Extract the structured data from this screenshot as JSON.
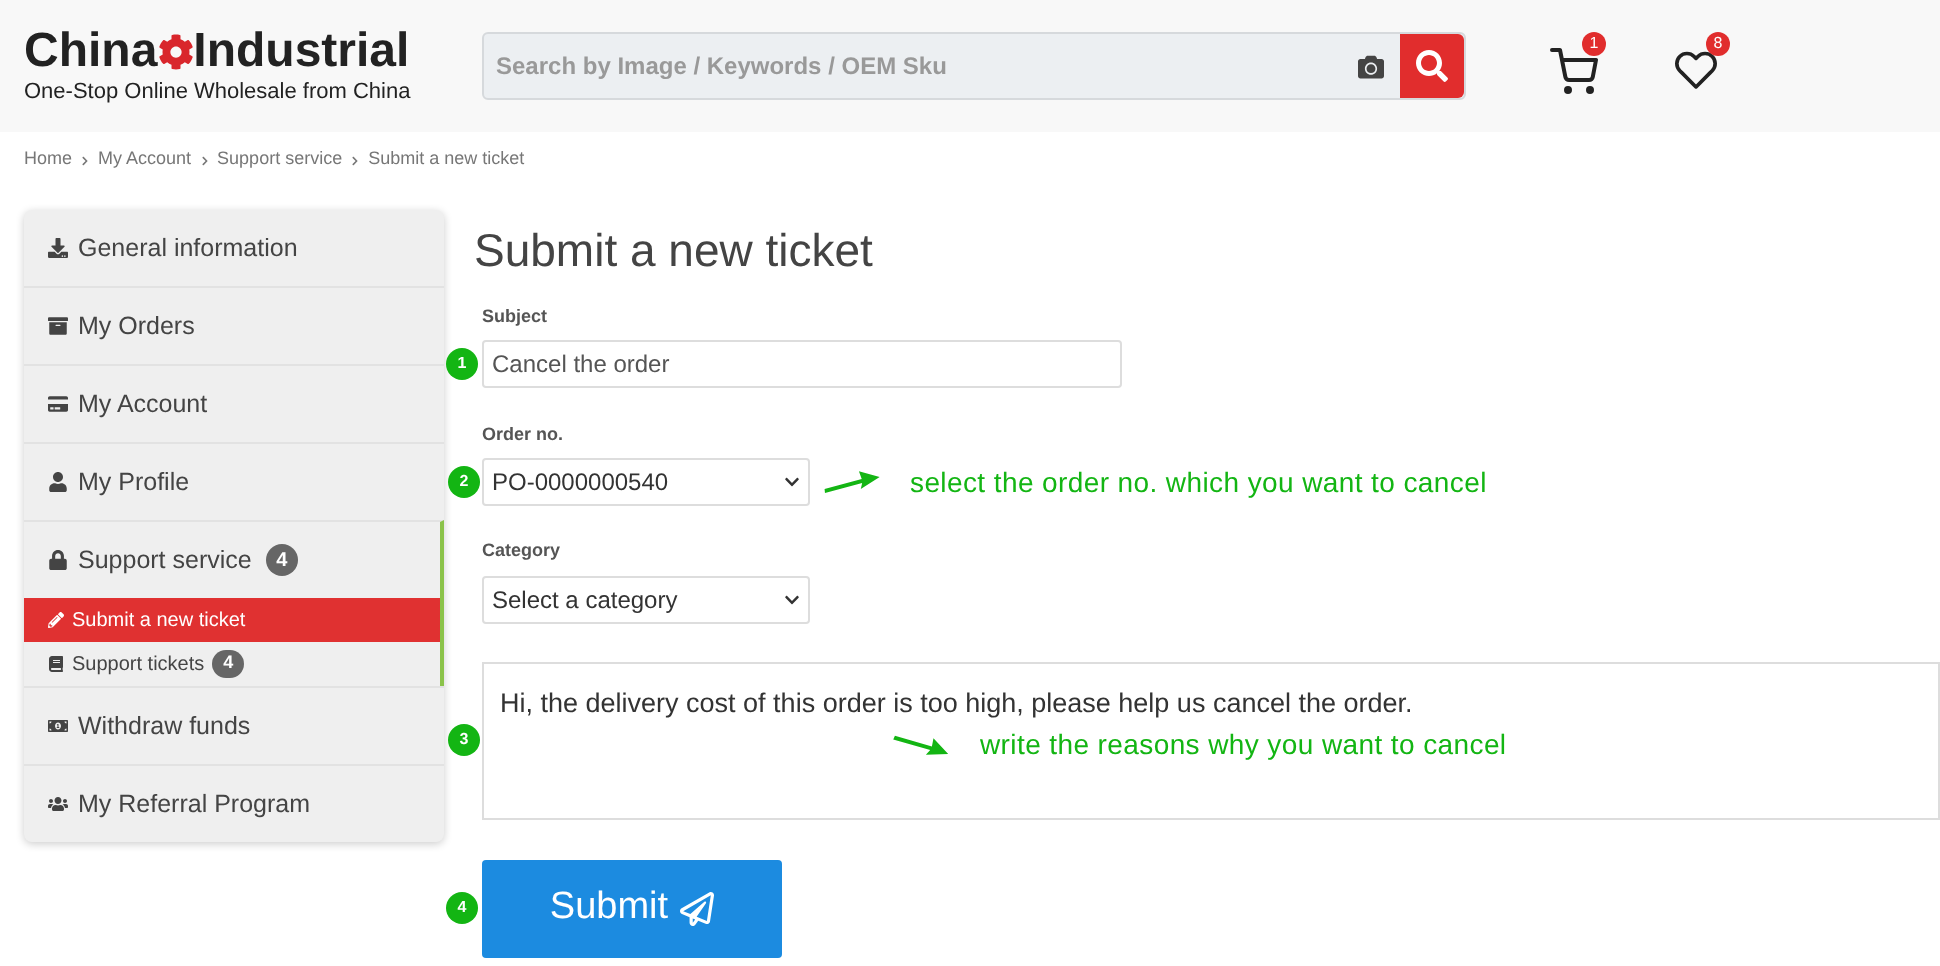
{
  "header": {
    "logo": {
      "left": "China",
      "right": "Industrial",
      "tagline": "One-Stop Online Wholesale from China"
    },
    "search": {
      "placeholder": "Search by Image / Keywords / OEM Sku"
    },
    "cart_count": "1",
    "wishlist_count": "8"
  },
  "breadcrumb": [
    "Home",
    "My Account",
    "Support service",
    "Submit a new ticket"
  ],
  "sidebar": {
    "items": [
      {
        "label": "General information"
      },
      {
        "label": "My Orders"
      },
      {
        "label": "My Account"
      },
      {
        "label": "My Profile"
      },
      {
        "label": "Support service",
        "badge": "4",
        "children": [
          {
            "label": "Submit a new ticket",
            "selected": true
          },
          {
            "label": "Support tickets",
            "badge": "4",
            "selected": false
          }
        ]
      },
      {
        "label": "Withdraw funds"
      },
      {
        "label": "My Referral Program"
      }
    ]
  },
  "form": {
    "title": "Submit a new ticket",
    "subject": {
      "label": "Subject",
      "value": "Cancel the order",
      "step": "1"
    },
    "order_no": {
      "label": "Order no.",
      "value": "PO-0000000540",
      "step": "2",
      "hint": "select the order no. which you want to cancel"
    },
    "category": {
      "label": "Category",
      "value": "Select a category"
    },
    "message": {
      "value": "Hi, the delivery cost of this order is too high, please help us cancel the order.",
      "step": "3",
      "hint": "write the reasons why you want to cancel"
    },
    "submit": {
      "label": "Submit",
      "step": "4"
    }
  }
}
